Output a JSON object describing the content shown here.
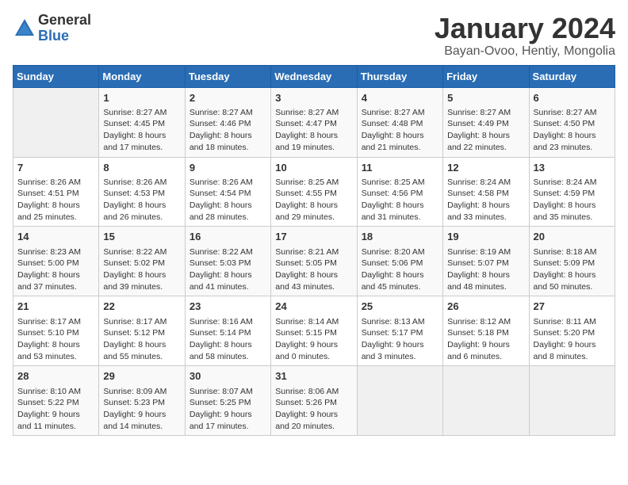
{
  "logo": {
    "general": "General",
    "blue": "Blue"
  },
  "title": "January 2024",
  "subtitle": "Bayan-Ovoo, Hentiy, Mongolia",
  "headers": [
    "Sunday",
    "Monday",
    "Tuesday",
    "Wednesday",
    "Thursday",
    "Friday",
    "Saturday"
  ],
  "weeks": [
    [
      {
        "day": "",
        "content": ""
      },
      {
        "day": "1",
        "content": "Sunrise: 8:27 AM\nSunset: 4:45 PM\nDaylight: 8 hours\nand 17 minutes."
      },
      {
        "day": "2",
        "content": "Sunrise: 8:27 AM\nSunset: 4:46 PM\nDaylight: 8 hours\nand 18 minutes."
      },
      {
        "day": "3",
        "content": "Sunrise: 8:27 AM\nSunset: 4:47 PM\nDaylight: 8 hours\nand 19 minutes."
      },
      {
        "day": "4",
        "content": "Sunrise: 8:27 AM\nSunset: 4:48 PM\nDaylight: 8 hours\nand 21 minutes."
      },
      {
        "day": "5",
        "content": "Sunrise: 8:27 AM\nSunset: 4:49 PM\nDaylight: 8 hours\nand 22 minutes."
      },
      {
        "day": "6",
        "content": "Sunrise: 8:27 AM\nSunset: 4:50 PM\nDaylight: 8 hours\nand 23 minutes."
      }
    ],
    [
      {
        "day": "7",
        "content": ""
      },
      {
        "day": "8",
        "content": "Sunrise: 8:26 AM\nSunset: 4:53 PM\nDaylight: 8 hours\nand 26 minutes."
      },
      {
        "day": "9",
        "content": "Sunrise: 8:26 AM\nSunset: 4:54 PM\nDaylight: 8 hours\nand 28 minutes."
      },
      {
        "day": "10",
        "content": "Sunrise: 8:25 AM\nSunset: 4:55 PM\nDaylight: 8 hours\nand 29 minutes."
      },
      {
        "day": "11",
        "content": "Sunrise: 8:25 AM\nSunset: 4:56 PM\nDaylight: 8 hours\nand 31 minutes."
      },
      {
        "day": "12",
        "content": "Sunrise: 8:24 AM\nSunset: 4:58 PM\nDaylight: 8 hours\nand 33 minutes."
      },
      {
        "day": "13",
        "content": "Sunrise: 8:24 AM\nSunset: 4:59 PM\nDaylight: 8 hours\nand 35 minutes."
      }
    ],
    [
      {
        "day": "14",
        "content": "Sunrise: 8:23 AM\nSunset: 5:00 PM\nDaylight: 8 hours\nand 37 minutes."
      },
      {
        "day": "15",
        "content": "Sunrise: 8:22 AM\nSunset: 5:02 PM\nDaylight: 8 hours\nand 39 minutes."
      },
      {
        "day": "16",
        "content": "Sunrise: 8:22 AM\nSunset: 5:03 PM\nDaylight: 8 hours\nand 41 minutes."
      },
      {
        "day": "17",
        "content": "Sunrise: 8:21 AM\nSunset: 5:05 PM\nDaylight: 8 hours\nand 43 minutes."
      },
      {
        "day": "18",
        "content": "Sunrise: 8:20 AM\nSunset: 5:06 PM\nDaylight: 8 hours\nand 45 minutes."
      },
      {
        "day": "19",
        "content": "Sunrise: 8:19 AM\nSunset: 5:07 PM\nDaylight: 8 hours\nand 48 minutes."
      },
      {
        "day": "20",
        "content": "Sunrise: 8:18 AM\nSunset: 5:09 PM\nDaylight: 8 hours\nand 50 minutes."
      }
    ],
    [
      {
        "day": "21",
        "content": "Sunrise: 8:17 AM\nSunset: 5:10 PM\nDaylight: 8 hours\nand 53 minutes."
      },
      {
        "day": "22",
        "content": "Sunrise: 8:17 AM\nSunset: 5:12 PM\nDaylight: 8 hours\nand 55 minutes."
      },
      {
        "day": "23",
        "content": "Sunrise: 8:16 AM\nSunset: 5:14 PM\nDaylight: 8 hours\nand 58 minutes."
      },
      {
        "day": "24",
        "content": "Sunrise: 8:14 AM\nSunset: 5:15 PM\nDaylight: 9 hours\nand 0 minutes."
      },
      {
        "day": "25",
        "content": "Sunrise: 8:13 AM\nSunset: 5:17 PM\nDaylight: 9 hours\nand 3 minutes."
      },
      {
        "day": "26",
        "content": "Sunrise: 8:12 AM\nSunset: 5:18 PM\nDaylight: 9 hours\nand 6 minutes."
      },
      {
        "day": "27",
        "content": "Sunrise: 8:11 AM\nSunset: 5:20 PM\nDaylight: 9 hours\nand 8 minutes."
      }
    ],
    [
      {
        "day": "28",
        "content": "Sunrise: 8:10 AM\nSunset: 5:22 PM\nDaylight: 9 hours\nand 11 minutes."
      },
      {
        "day": "29",
        "content": "Sunrise: 8:09 AM\nSunset: 5:23 PM\nDaylight: 9 hours\nand 14 minutes."
      },
      {
        "day": "30",
        "content": "Sunrise: 8:07 AM\nSunset: 5:25 PM\nDaylight: 9 hours\nand 17 minutes."
      },
      {
        "day": "31",
        "content": "Sunrise: 8:06 AM\nSunset: 5:26 PM\nDaylight: 9 hours\nand 20 minutes."
      },
      {
        "day": "",
        "content": ""
      },
      {
        "day": "",
        "content": ""
      },
      {
        "day": "",
        "content": ""
      }
    ]
  ],
  "week7_sunday_content": "Sunrise: 8:26 AM\nSunset: 4:51 PM\nDaylight: 8 hours\nand 25 minutes."
}
